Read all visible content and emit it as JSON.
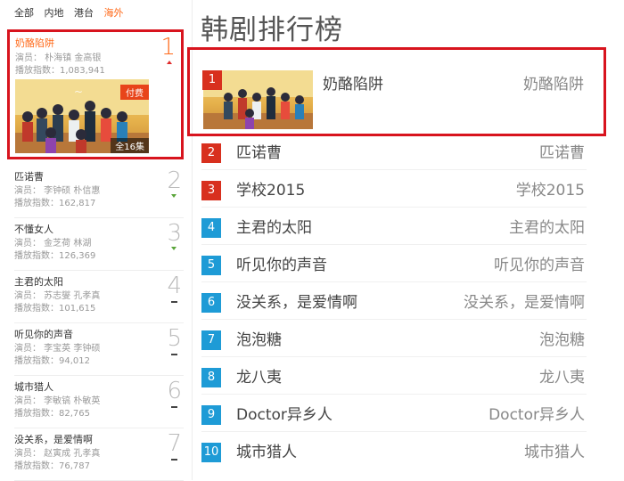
{
  "tabs": [
    "全部",
    "内地",
    "港台",
    "海外"
  ],
  "active_tab": "海外",
  "colors": {
    "accent": "#ff6a1a",
    "highlight_border": "#d8141e",
    "rank_red": "#d8301e",
    "rank_blue": "#1e9bd6",
    "trend_up": "#5aa53a"
  },
  "left_list": {
    "top": {
      "title": "奶酪陷阱",
      "actors": "演员： 朴海镇 金高银",
      "plays": "播放指数：1,083,941",
      "rank": "1",
      "badge": "付费",
      "episodes": "全16集"
    },
    "items": [
      {
        "title": "匹诺曹",
        "actors": "演员： 李钟硕 朴信惠",
        "plays": "播放指数：162,817",
        "rank": "2",
        "trend": "up"
      },
      {
        "title": "不懂女人",
        "actors": "演员： 金芝荷 林湖",
        "plays": "播放指数：126,369",
        "rank": "3",
        "trend": "up"
      },
      {
        "title": "主君的太阳",
        "actors": "演员： 苏志燮 孔孝真",
        "plays": "播放指数：101,615",
        "rank": "4",
        "trend": "flat"
      },
      {
        "title": "听见你的声音",
        "actors": "演员： 李宝英 李钟硕",
        "plays": "播放指数：94,012",
        "rank": "5",
        "trend": "flat"
      },
      {
        "title": "城市猎人",
        "actors": "演员： 李敏镐 朴敏英",
        "plays": "播放指数：82,765",
        "rank": "6",
        "trend": "flat"
      },
      {
        "title": "没关系，是爱情啊",
        "actors": "演员： 赵寅成 孔孝真",
        "plays": "播放指数：76,787",
        "rank": "7",
        "trend": "flat"
      }
    ]
  },
  "right_panel": {
    "title": "韩剧排行榜",
    "feature": {
      "rank": "1",
      "title": "奶酪陷阱",
      "title_right": "奶酪陷阱"
    },
    "items": [
      {
        "rank": "2",
        "title": "匹诺曹",
        "title_right": "匹诺曹",
        "color": "red"
      },
      {
        "rank": "3",
        "title": "学校2015",
        "title_right": "学校2015",
        "color": "red"
      },
      {
        "rank": "4",
        "title": "主君的太阳",
        "title_right": "主君的太阳",
        "color": "blue"
      },
      {
        "rank": "5",
        "title": "听见你的声音",
        "title_right": "听见你的声音",
        "color": "blue"
      },
      {
        "rank": "6",
        "title": "没关系，是爱情啊",
        "title_right": "没关系，是爱情啊",
        "color": "blue"
      },
      {
        "rank": "7",
        "title": "泡泡糖",
        "title_right": "泡泡糖",
        "color": "blue"
      },
      {
        "rank": "8",
        "title": "龙八夷",
        "title_right": "龙八夷",
        "color": "blue"
      },
      {
        "rank": "9",
        "title": "Doctor异乡人",
        "title_right": "Doctor异乡人",
        "color": "blue"
      },
      {
        "rank": "10",
        "title": "城市猎人",
        "title_right": "城市猎人",
        "color": "blue"
      }
    ]
  }
}
